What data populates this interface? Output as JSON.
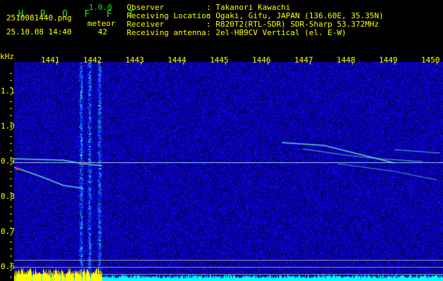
{
  "app": {
    "name_letters": [
      "H",
      "R",
      "O",
      "F",
      "F",
      "T"
    ],
    "version": "1.0.0"
  },
  "file": {
    "name": "2510081440.png",
    "datetime": "25.10.08 14:40"
  },
  "meteor": {
    "label": "meteor",
    "count": "42"
  },
  "info": [
    {
      "label": "Observer",
      "value": ": Takanori Kawachi"
    },
    {
      "label": "Receiving Location",
      "value": ": Ogaki, Gifu, JAPAN (136.60E, 35.35N)"
    },
    {
      "label": "Receiver",
      "value": ": R820T2(RTL-SDR) SDR-Sharp 53.372MHz"
    },
    {
      "label": "Receiving antenna",
      "value": ": 2el-HB9CV Vertical (el. E-W)"
    }
  ],
  "axis": {
    "y_unit": "kHz",
    "x_ticks": [
      "1441",
      "1442",
      "1443",
      "1444",
      "1445",
      "1446",
      "1447",
      "1448",
      "1449",
      "1450"
    ],
    "y_ticks": [
      "1.1",
      "1.0",
      "0.9",
      "0.8",
      "0.7",
      "0.6"
    ]
  },
  "colors": {
    "text": "#ffff00",
    "title": "#22e022",
    "level_bar": "#ffff00",
    "level_base": "#00ffff"
  }
}
